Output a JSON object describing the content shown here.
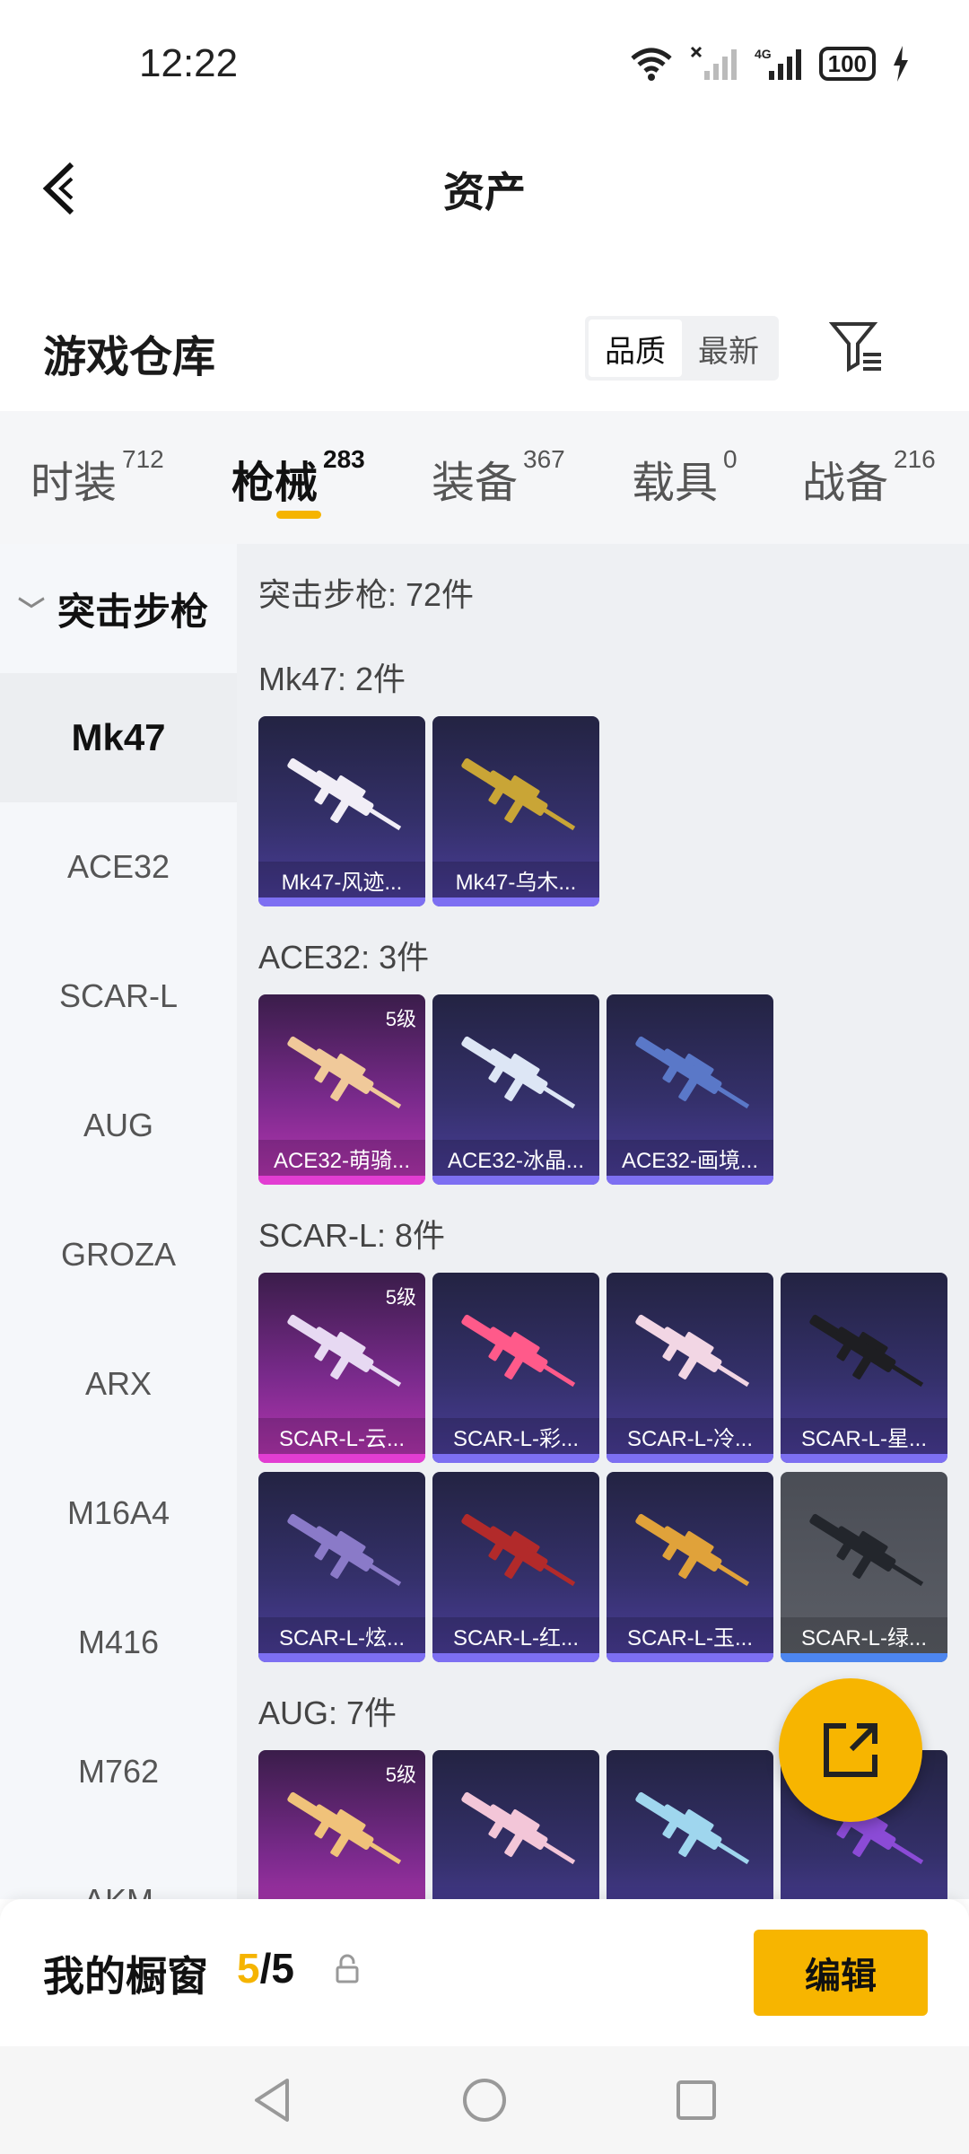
{
  "status": {
    "time": "12:22",
    "network": "4G",
    "battery": "100"
  },
  "header": {
    "title": "资产"
  },
  "warehouse": {
    "title": "游戏仓库",
    "sort": {
      "quality": "品质",
      "latest": "最新"
    }
  },
  "tabs": [
    {
      "label": "时装",
      "count": "712"
    },
    {
      "label": "枪械",
      "count": "283"
    },
    {
      "label": "装备",
      "count": "367"
    },
    {
      "label": "载具",
      "count": "0"
    },
    {
      "label": "战备",
      "count": "216"
    }
  ],
  "side": {
    "category": "突击步枪",
    "items": [
      "Mk47",
      "ACE32",
      "SCAR-L",
      "AUG",
      "GROZA",
      "ARX",
      "M16A4",
      "M416",
      "M762",
      "AKM"
    ]
  },
  "main": {
    "summary": "突击步枪: 72件",
    "groups": [
      {
        "title": "Mk47: 2件",
        "items": [
          {
            "name": "Mk47-风迹...",
            "level": ""
          },
          {
            "name": "Mk47-乌木...",
            "level": ""
          }
        ]
      },
      {
        "title": "ACE32: 3件",
        "items": [
          {
            "name": "ACE32-萌骑...",
            "level": "5级"
          },
          {
            "name": "ACE32-冰晶...",
            "level": ""
          },
          {
            "name": "ACE32-画境...",
            "level": ""
          }
        ]
      },
      {
        "title": "SCAR-L: 8件",
        "items": [
          {
            "name": "SCAR-L-云...",
            "level": "5级"
          },
          {
            "name": "SCAR-L-彩...",
            "level": ""
          },
          {
            "name": "SCAR-L-冷...",
            "level": ""
          },
          {
            "name": "SCAR-L-星...",
            "level": ""
          },
          {
            "name": "SCAR-L-炫...",
            "level": ""
          },
          {
            "name": "SCAR-L-红...",
            "level": ""
          },
          {
            "name": "SCAR-L-玉...",
            "level": ""
          },
          {
            "name": "SCAR-L-绿...",
            "level": ""
          }
        ]
      },
      {
        "title": "AUG: 7件",
        "items": [
          {
            "name": "",
            "level": "5级"
          },
          {
            "name": "",
            "level": ""
          },
          {
            "name": "",
            "level": ""
          },
          {
            "name": "",
            "level": ""
          }
        ]
      }
    ]
  },
  "bottom": {
    "label": "我的橱窗",
    "count_current": "5",
    "count_total": "/5",
    "edit": "编辑"
  },
  "colors": {
    "accent": "#f7b500",
    "quality5": "#e23dd2",
    "quality4": "#7d6ff2",
    "quality_grey": "#4d86ef"
  },
  "icons": [
    "back-icon",
    "filter-icon",
    "lock-icon",
    "share-icon",
    "nav-back-icon",
    "nav-home-icon",
    "nav-recents-icon"
  ]
}
